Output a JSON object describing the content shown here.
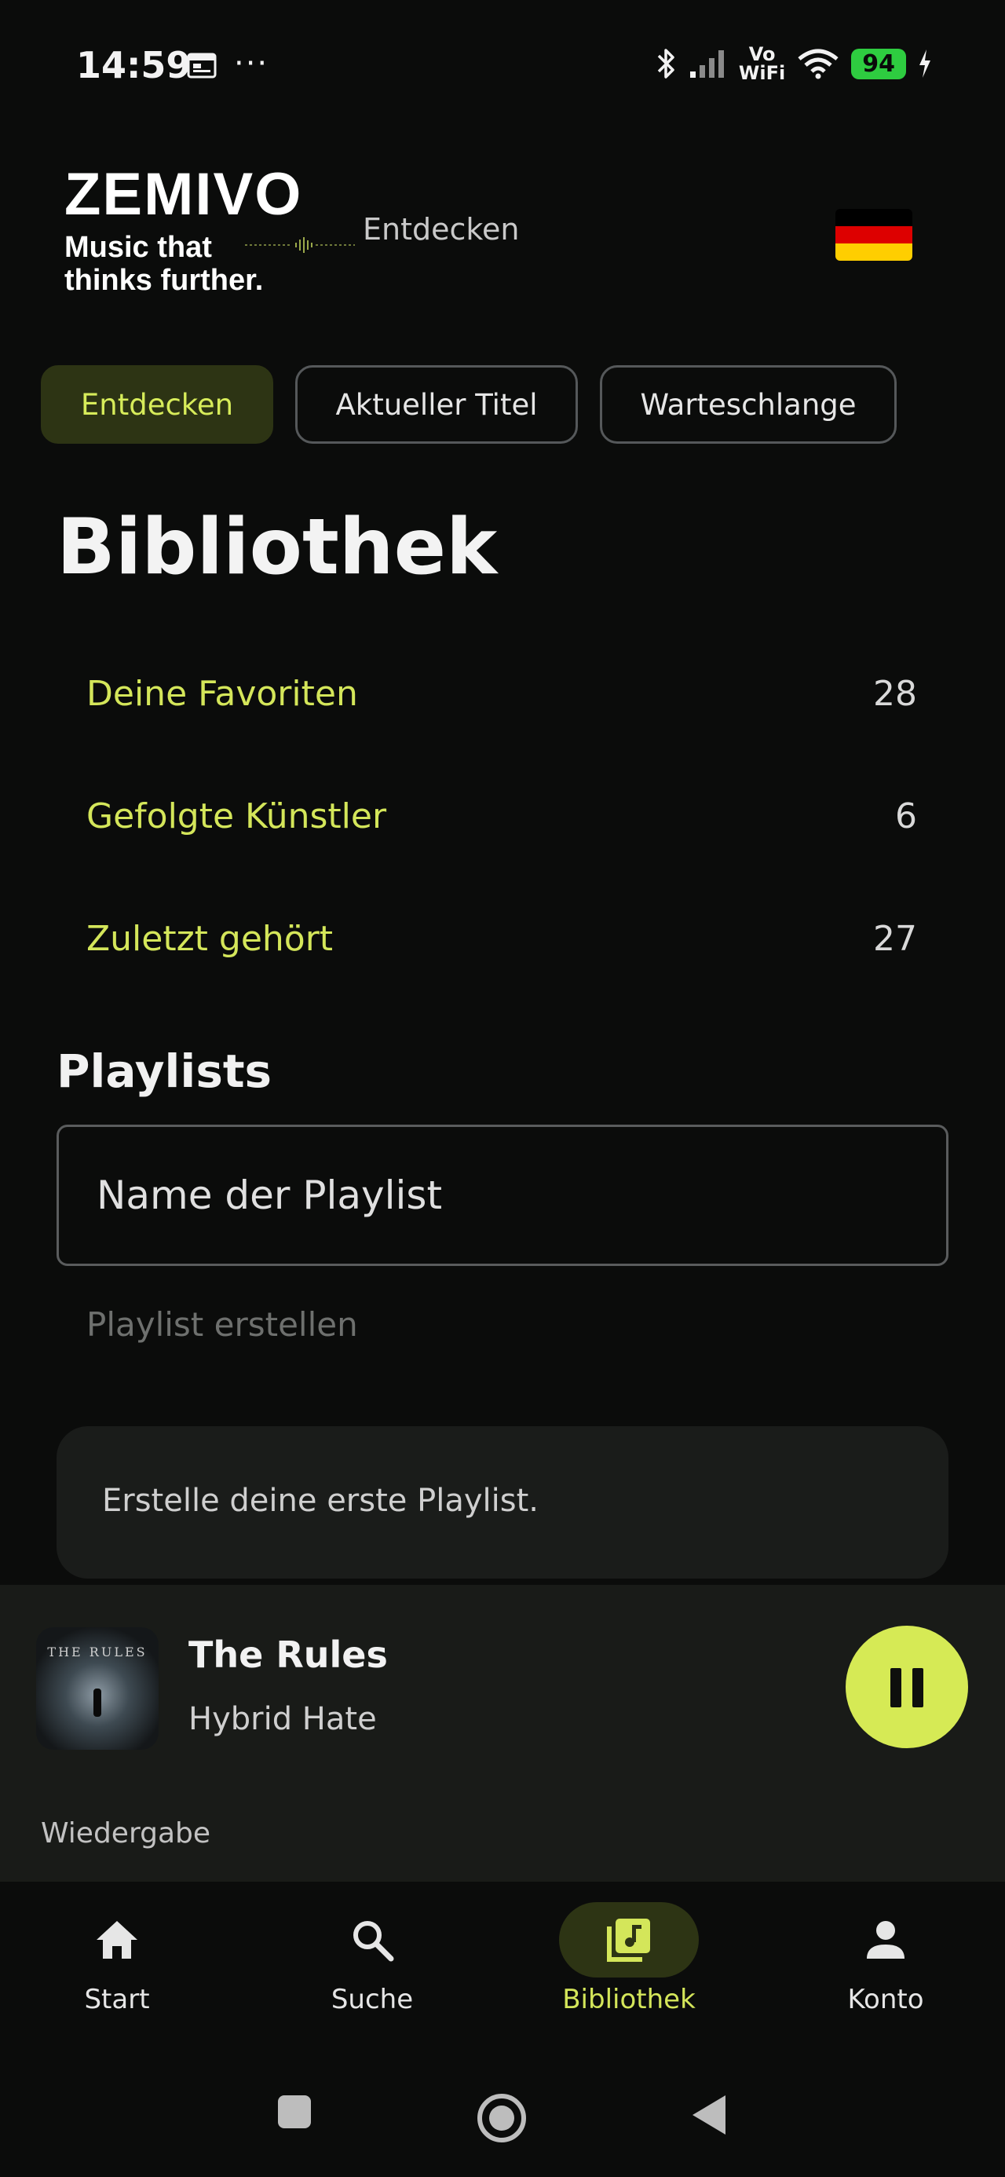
{
  "status_bar": {
    "time": "14:59",
    "more": "···",
    "vowifi": [
      "Vo",
      "WiFi"
    ],
    "battery": "94",
    "icons": [
      "calendar-icon",
      "bluetooth-icon",
      "signal-icon",
      "wifi-icon",
      "battery-icon",
      "charging-icon"
    ]
  },
  "header": {
    "brand": "ZEMIVO",
    "tagline_line1": "Music that",
    "tagline_line2": "thinks further.",
    "link": "Entdecken",
    "flag_colors": [
      "#000000",
      "#dd0000",
      "#ffce00"
    ]
  },
  "tabs": [
    {
      "label": "Entdecken",
      "active": true
    },
    {
      "label": "Aktueller Titel",
      "active": false
    },
    {
      "label": "Warteschlange",
      "active": false
    }
  ],
  "library": {
    "title": "Bibliothek",
    "rows": [
      {
        "label": "Deine Favoriten",
        "count": "28"
      },
      {
        "label": "Gefolgte Künstler",
        "count": "6"
      },
      {
        "label": "Zuletzt gehört",
        "count": "27"
      }
    ]
  },
  "playlists": {
    "title": "Playlists",
    "input_placeholder": "Name der Playlist",
    "create_label": "Playlist erstellen",
    "empty_message": "Erstelle deine erste Playlist."
  },
  "now_playing": {
    "cover_text": "THE RULES",
    "title": "The Rules",
    "artist": "Hybrid Hate",
    "section_label": "Wiedergabe",
    "state": "playing"
  },
  "bottom_nav": [
    {
      "label": "Start",
      "icon": "home-icon",
      "active": false
    },
    {
      "label": "Suche",
      "icon": "search-icon",
      "active": false
    },
    {
      "label": "Bibliothek",
      "icon": "library-music-icon",
      "active": true
    },
    {
      "label": "Konto",
      "icon": "account-icon",
      "active": false
    }
  ],
  "colors": {
    "background": "#0b0c0b",
    "accent": "#d4e65a",
    "accent_pill": "#2d3414",
    "card": "#1a1c1a",
    "player_bg": "#191b18"
  }
}
